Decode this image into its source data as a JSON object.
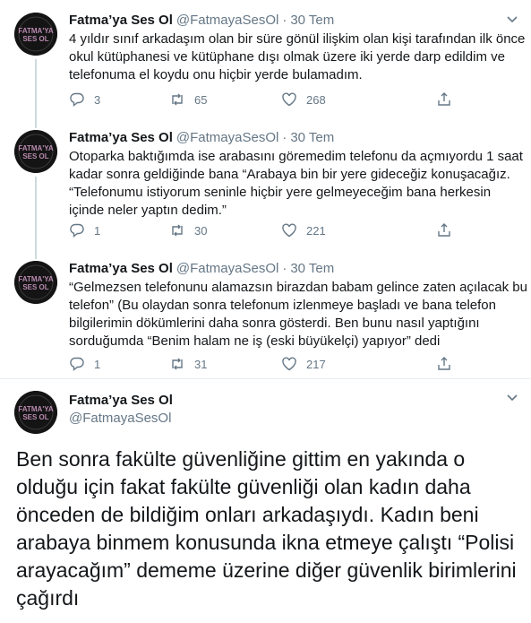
{
  "colors": {
    "text": "#14171a",
    "secondary": "#657786",
    "divider": "#e6ecf0",
    "avatar_bg": "#141414",
    "avatar_text": "#b98ab0"
  },
  "author": {
    "name": "Fatma’ya Ses Ol",
    "handle": "@FatmayaSesOl",
    "avatar_text_line1": "FATMA'YA",
    "avatar_text_line2": "SES OL"
  },
  "tweets": [
    {
      "date": "30 Tem",
      "lines": [
        "4 yıldır sınıf arkadaşım olan bir süre gönül ilişkim olan kişi tarafından ilk önce",
        "okul kütüphanesi ve kütüphane dışı olmak üzere iki yerde darp edildim ve",
        "telefonuma el koydu onu hiçbir yerde bulamadım."
      ],
      "replies": "3",
      "retweets": "65",
      "likes": "268"
    },
    {
      "date": "30 Tem",
      "lines": [
        "Otoparka baktığımda ise arabasını göremedim telefonu da açmıyordu 1 saat",
        "kadar sonra geldiğinde bana “Arabaya bin bir yere gideceğiz konuşacağız.",
        "“Telefonumu istiyorum seninle hiçbir yere gelmeyeceğim bana herkesin",
        "içinde neler yaptın dedim.”"
      ],
      "replies": "1",
      "retweets": "30",
      "likes": "221"
    },
    {
      "date": "30 Tem",
      "lines": [
        "“Gelmezsen telefonunu alamazsın birazdan babam gelince zaten açılacak bu",
        "telefon” (Bu olaydan sonra telefonum izlenmeye başladı ve bana telefon",
        "bilgilerimin dökümlerini daha sonra gösterdi. Ben bunu nasıl yaptığını",
        "sorduğumda “Benim halam ne iş (eski büyükelçi) yapıyor” dedi"
      ],
      "replies": "1",
      "retweets": "31",
      "likes": "217"
    }
  ],
  "main_tweet": {
    "lines": [
      "Ben sonra fakülte güvenliğine gittim en yakında o",
      "olduğu için fakat fakülte güvenliği olan kadın daha",
      "önceden de bildiğim onları arkadaşıydı. Kadın beni",
      "arabaya binmem konusunda ikna etmeye çalıştı “Polisi",
      "arayacağım” dememe üzerine diğer güvenlik birimlerini",
      "çağırdı"
    ]
  },
  "icons": {
    "reply": "reply-icon",
    "retweet": "retweet-icon",
    "like": "heart-icon",
    "share": "share-icon",
    "caret": "chevron-down-icon"
  }
}
